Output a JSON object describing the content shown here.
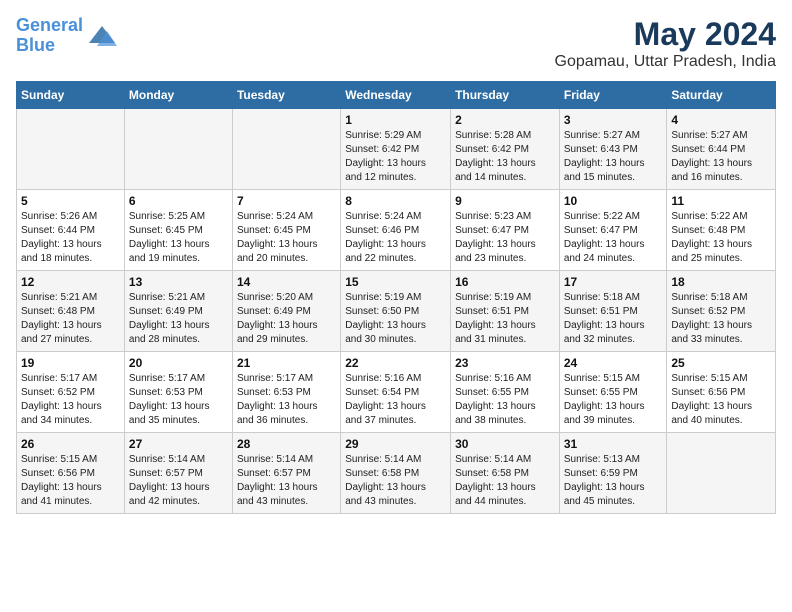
{
  "header": {
    "logo_line1": "General",
    "logo_line2": "Blue",
    "title": "May 2024",
    "subtitle": "Gopamau, Uttar Pradesh, India"
  },
  "days_of_week": [
    "Sunday",
    "Monday",
    "Tuesday",
    "Wednesday",
    "Thursday",
    "Friday",
    "Saturday"
  ],
  "weeks": [
    [
      {
        "day": "",
        "info": ""
      },
      {
        "day": "",
        "info": ""
      },
      {
        "day": "",
        "info": ""
      },
      {
        "day": "1",
        "info": "Sunrise: 5:29 AM\nSunset: 6:42 PM\nDaylight: 13 hours\nand 12 minutes."
      },
      {
        "day": "2",
        "info": "Sunrise: 5:28 AM\nSunset: 6:42 PM\nDaylight: 13 hours\nand 14 minutes."
      },
      {
        "day": "3",
        "info": "Sunrise: 5:27 AM\nSunset: 6:43 PM\nDaylight: 13 hours\nand 15 minutes."
      },
      {
        "day": "4",
        "info": "Sunrise: 5:27 AM\nSunset: 6:44 PM\nDaylight: 13 hours\nand 16 minutes."
      }
    ],
    [
      {
        "day": "5",
        "info": "Sunrise: 5:26 AM\nSunset: 6:44 PM\nDaylight: 13 hours\nand 18 minutes."
      },
      {
        "day": "6",
        "info": "Sunrise: 5:25 AM\nSunset: 6:45 PM\nDaylight: 13 hours\nand 19 minutes."
      },
      {
        "day": "7",
        "info": "Sunrise: 5:24 AM\nSunset: 6:45 PM\nDaylight: 13 hours\nand 20 minutes."
      },
      {
        "day": "8",
        "info": "Sunrise: 5:24 AM\nSunset: 6:46 PM\nDaylight: 13 hours\nand 22 minutes."
      },
      {
        "day": "9",
        "info": "Sunrise: 5:23 AM\nSunset: 6:47 PM\nDaylight: 13 hours\nand 23 minutes."
      },
      {
        "day": "10",
        "info": "Sunrise: 5:22 AM\nSunset: 6:47 PM\nDaylight: 13 hours\nand 24 minutes."
      },
      {
        "day": "11",
        "info": "Sunrise: 5:22 AM\nSunset: 6:48 PM\nDaylight: 13 hours\nand 25 minutes."
      }
    ],
    [
      {
        "day": "12",
        "info": "Sunrise: 5:21 AM\nSunset: 6:48 PM\nDaylight: 13 hours\nand 27 minutes."
      },
      {
        "day": "13",
        "info": "Sunrise: 5:21 AM\nSunset: 6:49 PM\nDaylight: 13 hours\nand 28 minutes."
      },
      {
        "day": "14",
        "info": "Sunrise: 5:20 AM\nSunset: 6:49 PM\nDaylight: 13 hours\nand 29 minutes."
      },
      {
        "day": "15",
        "info": "Sunrise: 5:19 AM\nSunset: 6:50 PM\nDaylight: 13 hours\nand 30 minutes."
      },
      {
        "day": "16",
        "info": "Sunrise: 5:19 AM\nSunset: 6:51 PM\nDaylight: 13 hours\nand 31 minutes."
      },
      {
        "day": "17",
        "info": "Sunrise: 5:18 AM\nSunset: 6:51 PM\nDaylight: 13 hours\nand 32 minutes."
      },
      {
        "day": "18",
        "info": "Sunrise: 5:18 AM\nSunset: 6:52 PM\nDaylight: 13 hours\nand 33 minutes."
      }
    ],
    [
      {
        "day": "19",
        "info": "Sunrise: 5:17 AM\nSunset: 6:52 PM\nDaylight: 13 hours\nand 34 minutes."
      },
      {
        "day": "20",
        "info": "Sunrise: 5:17 AM\nSunset: 6:53 PM\nDaylight: 13 hours\nand 35 minutes."
      },
      {
        "day": "21",
        "info": "Sunrise: 5:17 AM\nSunset: 6:53 PM\nDaylight: 13 hours\nand 36 minutes."
      },
      {
        "day": "22",
        "info": "Sunrise: 5:16 AM\nSunset: 6:54 PM\nDaylight: 13 hours\nand 37 minutes."
      },
      {
        "day": "23",
        "info": "Sunrise: 5:16 AM\nSunset: 6:55 PM\nDaylight: 13 hours\nand 38 minutes."
      },
      {
        "day": "24",
        "info": "Sunrise: 5:15 AM\nSunset: 6:55 PM\nDaylight: 13 hours\nand 39 minutes."
      },
      {
        "day": "25",
        "info": "Sunrise: 5:15 AM\nSunset: 6:56 PM\nDaylight: 13 hours\nand 40 minutes."
      }
    ],
    [
      {
        "day": "26",
        "info": "Sunrise: 5:15 AM\nSunset: 6:56 PM\nDaylight: 13 hours\nand 41 minutes."
      },
      {
        "day": "27",
        "info": "Sunrise: 5:14 AM\nSunset: 6:57 PM\nDaylight: 13 hours\nand 42 minutes."
      },
      {
        "day": "28",
        "info": "Sunrise: 5:14 AM\nSunset: 6:57 PM\nDaylight: 13 hours\nand 43 minutes."
      },
      {
        "day": "29",
        "info": "Sunrise: 5:14 AM\nSunset: 6:58 PM\nDaylight: 13 hours\nand 43 minutes."
      },
      {
        "day": "30",
        "info": "Sunrise: 5:14 AM\nSunset: 6:58 PM\nDaylight: 13 hours\nand 44 minutes."
      },
      {
        "day": "31",
        "info": "Sunrise: 5:13 AM\nSunset: 6:59 PM\nDaylight: 13 hours\nand 45 minutes."
      },
      {
        "day": "",
        "info": ""
      }
    ]
  ]
}
